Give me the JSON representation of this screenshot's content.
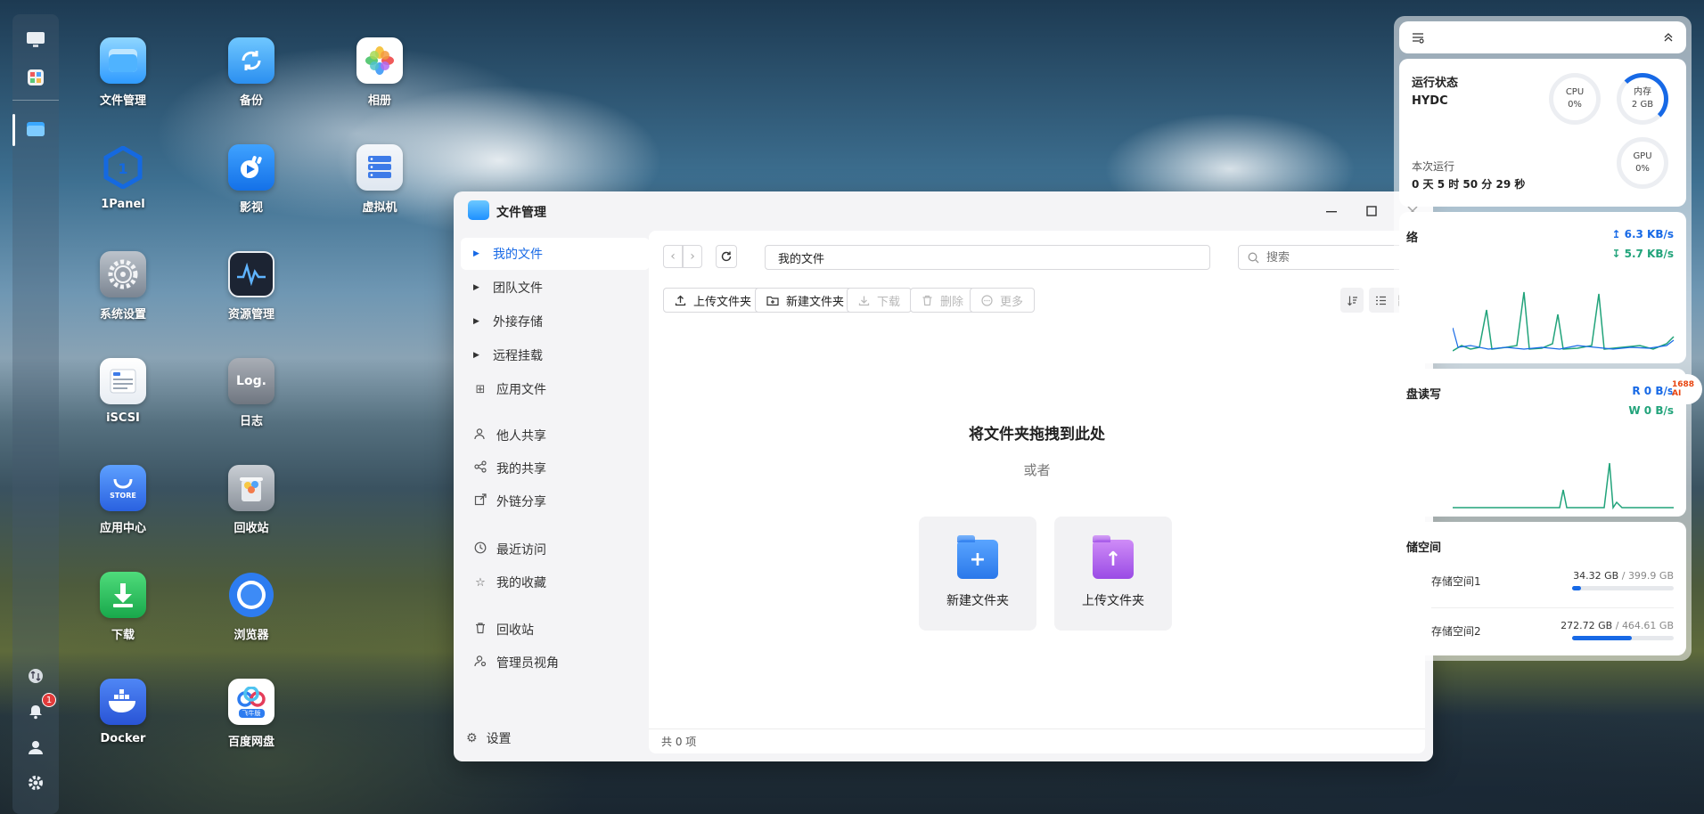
{
  "desktop": {
    "icons": [
      {
        "label": "文件管理"
      },
      {
        "label": "备份"
      },
      {
        "label": "相册"
      },
      {
        "label": "1Panel"
      },
      {
        "label": "影视"
      },
      {
        "label": "虚拟机"
      },
      {
        "label": "系统设置"
      },
      {
        "label": "资源管理"
      },
      {
        "label": "iSCSI"
      },
      {
        "label": "日志"
      },
      {
        "label": "应用中心"
      },
      {
        "label": "回收站"
      },
      {
        "label": "下载"
      },
      {
        "label": "浏览器"
      },
      {
        "label": "Docker"
      },
      {
        "label": "百度网盘"
      }
    ],
    "tile_texts": {
      "log": "Log.",
      "store": "STORE",
      "baidu": "飞牛版"
    }
  },
  "dock": {
    "notification_count": "1"
  },
  "window": {
    "title": "文件管理",
    "sidebar": {
      "items": [
        {
          "label": "我的文件"
        },
        {
          "label": "团队文件"
        },
        {
          "label": "外接存储"
        },
        {
          "label": "远程挂载"
        },
        {
          "label": "应用文件"
        },
        {
          "label": "他人共享"
        },
        {
          "label": "我的共享"
        },
        {
          "label": "外链分享"
        },
        {
          "label": "最近访问"
        },
        {
          "label": "我的收藏"
        },
        {
          "label": "回收站"
        },
        {
          "label": "管理员视角"
        }
      ],
      "settings_label": "设置"
    },
    "path": "我的文件",
    "search_placeholder": "搜索",
    "toolbar": {
      "upload_folder": "上传文件夹",
      "new_folder": "新建文件夹",
      "download": "下载",
      "delete": "删除",
      "more": "更多"
    },
    "empty": {
      "title": "将文件夹拖拽到此处",
      "or": "或者",
      "new_folder_card": "新建文件夹",
      "upload_folder_card": "上传文件夹"
    },
    "footer": "共 0 项"
  },
  "widgets": {
    "status": {
      "title": "运行状态",
      "host": "HYDC",
      "cpu_label": "CPU",
      "cpu_value": "0%",
      "mem_label": "内存",
      "mem_value": "2 GB",
      "gpu_label": "GPU",
      "gpu_value": "0%",
      "uptime_label": "本次运行",
      "uptime_value": "0 天 5 时 50 分 29 秒"
    },
    "network": {
      "title": "络",
      "up": "6.3 KB/s",
      "down": "5.7 KB/s"
    },
    "disk": {
      "title": "盘读写",
      "read_label": "R",
      "read": "0 B/s",
      "write_label": "W",
      "write": "0 B/s"
    },
    "storage": {
      "title": "储空间",
      "pools": [
        {
          "name": "存储空间1",
          "used": "34.32 GB",
          "total": "399.9 GB",
          "fraction": 0.086
        },
        {
          "name": "存储空间2",
          "used": "272.72 GB",
          "total": "464.61 GB",
          "fraction": 0.587
        }
      ]
    }
  },
  "ai_badge": "1688 AI",
  "colors": {
    "accent": "#1769e6",
    "net_green": "#21a37a",
    "net_blue": "#1769e6"
  }
}
